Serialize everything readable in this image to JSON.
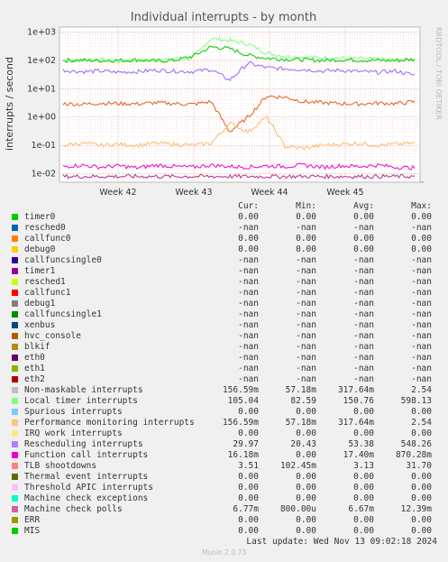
{
  "chart_data": {
    "type": "line",
    "title": "Individual interrupts - by month",
    "ylabel": "interrupts / second",
    "yscale": "log",
    "ylim": [
      0.005,
      1000
    ],
    "yticks": [
      "1e+03",
      "1e+02",
      "1e+01",
      "1e+00",
      "1e-01",
      "1e-02"
    ],
    "xticks": [
      "Week 42",
      "Week 43",
      "Week 44",
      "Week 45"
    ],
    "grid": true,
    "series": [
      {
        "name": "Local timer interrupts",
        "color": "#80ff80",
        "values": [
          95,
          100,
          105,
          92,
          100,
          98,
          110,
          120,
          600,
          500,
          380,
          180,
          140,
          130,
          125,
          120,
          115,
          110,
          105,
          105
        ]
      },
      {
        "name": "Non-maskable interrupts",
        "color": "#00cc00",
        "values": [
          100,
          102,
          98,
          100,
          105,
          95,
          100,
          140,
          300,
          260,
          150,
          120,
          110,
          105,
          100,
          105,
          102,
          100,
          98,
          110
        ]
      },
      {
        "name": "Rescheduling interrupts",
        "color": "#9966ff",
        "values": [
          45,
          40,
          42,
          38,
          40,
          45,
          42,
          40,
          48,
          20,
          80,
          55,
          50,
          48,
          42,
          45,
          40,
          38,
          42,
          30
        ]
      },
      {
        "name": "TLB shootdowns",
        "color": "#e65c1a",
        "values": [
          3.0,
          2.8,
          3.1,
          3.0,
          2.9,
          3.2,
          3.0,
          2.8,
          3.5,
          0.3,
          1.0,
          5.5,
          5.0,
          3.5,
          3.2,
          3.0,
          2.9,
          3.1,
          3.0,
          3.5
        ]
      },
      {
        "name": "Machine check polls",
        "color": "#ffb870",
        "values": [
          0.1,
          0.12,
          0.1,
          0.11,
          0.1,
          0.12,
          0.11,
          0.1,
          0.12,
          0.6,
          0.3,
          1.0,
          0.09,
          0.08,
          0.1,
          0.11,
          0.12,
          0.1,
          0.11,
          0.12
        ]
      },
      {
        "name": "Function call interrupts",
        "color": "#ee00cc",
        "values": [
          0.018,
          0.02,
          0.017,
          0.019,
          0.016,
          0.02,
          0.018,
          0.017,
          0.02,
          0.018,
          0.017,
          0.019,
          0.018,
          0.02,
          0.017,
          0.019,
          0.018,
          0.02,
          0.017,
          0.016
        ]
      },
      {
        "name": "Performance monitoring interrupts",
        "color": "#aa3388",
        "values": [
          0.008,
          0.008,
          0.008,
          0.008,
          0.008,
          0.008,
          0.008,
          0.008,
          0.008,
          0.008,
          0.008,
          0.008,
          0.008,
          0.008,
          0.008,
          0.008,
          0.008,
          0.008,
          0.008,
          0.008
        ]
      }
    ]
  },
  "side_label": "RRDTOOL / TOBI OETIKER",
  "legend": {
    "headers": {
      "cur": "Cur:",
      "min": "Min:",
      "avg": "Avg:",
      "max": "Max:"
    },
    "rows": [
      {
        "color": "#00cc00",
        "name": "timer0",
        "cur": "0.00",
        "min": "0.00",
        "avg": "0.00",
        "max": "0.00"
      },
      {
        "color": "#0066b3",
        "name": "resched0",
        "cur": "-nan",
        "min": "-nan",
        "avg": "-nan",
        "max": "-nan"
      },
      {
        "color": "#ff8000",
        "name": "callfunc0",
        "cur": "0.00",
        "min": "0.00",
        "avg": "0.00",
        "max": "0.00"
      },
      {
        "color": "#ffcc00",
        "name": "debug0",
        "cur": "0.00",
        "min": "0.00",
        "avg": "0.00",
        "max": "0.00"
      },
      {
        "color": "#330099",
        "name": "callfuncsingle0",
        "cur": "-nan",
        "min": "-nan",
        "avg": "-nan",
        "max": "-nan"
      },
      {
        "color": "#990099",
        "name": "timer1",
        "cur": "-nan",
        "min": "-nan",
        "avg": "-nan",
        "max": "-nan"
      },
      {
        "color": "#ccff00",
        "name": "resched1",
        "cur": "-nan",
        "min": "-nan",
        "avg": "-nan",
        "max": "-nan"
      },
      {
        "color": "#ff0000",
        "name": "callfunc1",
        "cur": "-nan",
        "min": "-nan",
        "avg": "-nan",
        "max": "-nan"
      },
      {
        "color": "#808080",
        "name": "debug1",
        "cur": "-nan",
        "min": "-nan",
        "avg": "-nan",
        "max": "-nan"
      },
      {
        "color": "#008f00",
        "name": "callfuncsingle1",
        "cur": "-nan",
        "min": "-nan",
        "avg": "-nan",
        "max": "-nan"
      },
      {
        "color": "#00487d",
        "name": "xenbus",
        "cur": "-nan",
        "min": "-nan",
        "avg": "-nan",
        "max": "-nan"
      },
      {
        "color": "#b35a00",
        "name": "hvc_console",
        "cur": "-nan",
        "min": "-nan",
        "avg": "-nan",
        "max": "-nan"
      },
      {
        "color": "#b38f00",
        "name": "blkif",
        "cur": "-nan",
        "min": "-nan",
        "avg": "-nan",
        "max": "-nan"
      },
      {
        "color": "#6b006b",
        "name": "eth0",
        "cur": "-nan",
        "min": "-nan",
        "avg": "-nan",
        "max": "-nan"
      },
      {
        "color": "#8fb300",
        "name": "eth1",
        "cur": "-nan",
        "min": "-nan",
        "avg": "-nan",
        "max": "-nan"
      },
      {
        "color": "#b30000",
        "name": "eth2",
        "cur": "-nan",
        "min": "-nan",
        "avg": "-nan",
        "max": "-nan"
      },
      {
        "color": "#bebebe",
        "name": "Non-maskable interrupts",
        "cur": "156.59m",
        "min": "57.18m",
        "avg": "317.64m",
        "max": "2.54"
      },
      {
        "color": "#80ff80",
        "name": "Local timer interrupts",
        "cur": "105.04",
        "min": "82.59",
        "avg": "150.76",
        "max": "598.13"
      },
      {
        "color": "#80c9ff",
        "name": "Spurious interrupts",
        "cur": "0.00",
        "min": "0.00",
        "avg": "0.00",
        "max": "0.00"
      },
      {
        "color": "#ffc080",
        "name": "Performance monitoring interrupts",
        "cur": "156.59m",
        "min": "57.18m",
        "avg": "317.64m",
        "max": "2.54"
      },
      {
        "color": "#ffe680",
        "name": "IRQ work interrupts",
        "cur": "0.00",
        "min": "0.00",
        "avg": "0.00",
        "max": "0.00"
      },
      {
        "color": "#aa80ff",
        "name": "Rescheduling interrupts",
        "cur": "29.97",
        "min": "20.43",
        "avg": "53.38",
        "max": "548.26"
      },
      {
        "color": "#ee00cc",
        "name": "Function call interrupts",
        "cur": "16.18m",
        "min": "0.00",
        "avg": "17.40m",
        "max": "870.28m"
      },
      {
        "color": "#ff8080",
        "name": "TLB shootdowns",
        "cur": "3.51",
        "min": "102.45m",
        "avg": "3.13",
        "max": "31.70"
      },
      {
        "color": "#666600",
        "name": "Thermal event interrupts",
        "cur": "0.00",
        "min": "0.00",
        "avg": "0.00",
        "max": "0.00"
      },
      {
        "color": "#ffbfff",
        "name": "Threshold APIC interrupts",
        "cur": "0.00",
        "min": "0.00",
        "avg": "0.00",
        "max": "0.00"
      },
      {
        "color": "#00ffcc",
        "name": "Machine check exceptions",
        "cur": "0.00",
        "min": "0.00",
        "avg": "0.00",
        "max": "0.00"
      },
      {
        "color": "#cc6699",
        "name": "Machine check polls",
        "cur": "6.77m",
        "min": "800.00u",
        "avg": "6.67m",
        "max": "12.39m"
      },
      {
        "color": "#999900",
        "name": "ERR",
        "cur": "0.00",
        "min": "0.00",
        "avg": "0.00",
        "max": "0.00"
      },
      {
        "color": "#00cc00",
        "name": "MIS",
        "cur": "0.00",
        "min": "0.00",
        "avg": "0.00",
        "max": "0.00"
      }
    ]
  },
  "last_update": "Last update: Wed Nov 13 09:02:18 2024",
  "version": "Munin 2.0.73"
}
